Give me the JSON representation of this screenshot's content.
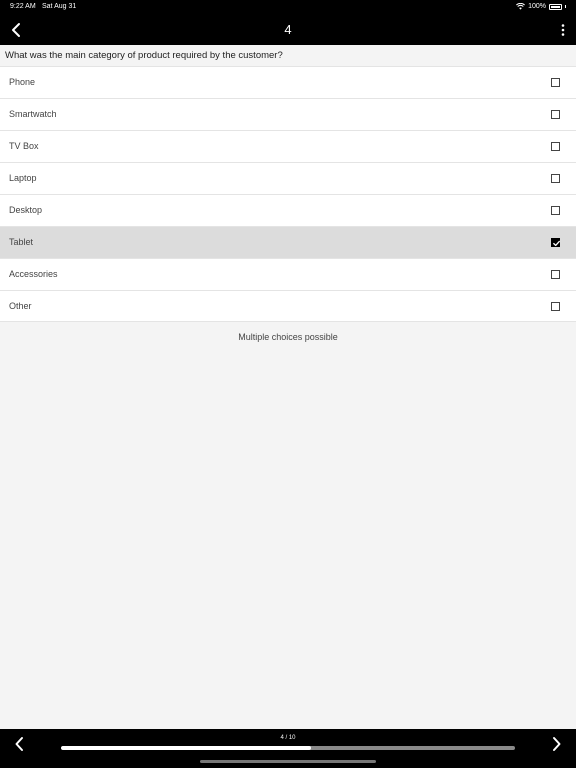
{
  "status": {
    "time": "9:22 AM",
    "date": "Sat Aug 31",
    "battery": "100%"
  },
  "nav": {
    "title": "4"
  },
  "question": "What was the main category of product required by the customer?",
  "options": [
    {
      "label": "Phone",
      "checked": false
    },
    {
      "label": "Smartwatch",
      "checked": false
    },
    {
      "label": "TV Box",
      "checked": false
    },
    {
      "label": "Laptop",
      "checked": false
    },
    {
      "label": "Desktop",
      "checked": false
    },
    {
      "label": "Tablet",
      "checked": true
    },
    {
      "label": "Accessories",
      "checked": false
    },
    {
      "label": "Other",
      "checked": false
    }
  ],
  "hint": "Multiple choices possible",
  "pager": {
    "label": "4 / 10",
    "current": 4,
    "total": 10,
    "progress": 0.55
  },
  "icons": {
    "back": "chevron-left-icon",
    "more": "more-vertical-icon",
    "prev": "chevron-left-icon",
    "next": "chevron-right-icon",
    "wifi": "wifi-icon",
    "battery": "battery-icon"
  },
  "colors": {
    "bar": "#000000",
    "background": "#f4f4f4",
    "selected_row": "#dcdcdc"
  }
}
